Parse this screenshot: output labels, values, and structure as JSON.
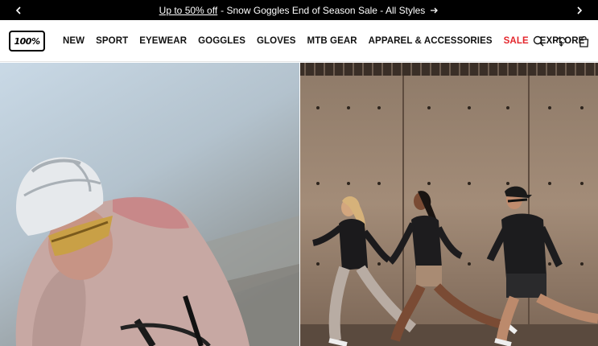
{
  "announcement": {
    "promo_link": "Up to 50% off",
    "message": " - Snow Goggles End of Season Sale - All Styles",
    "prev_icon": "chevron-left-icon",
    "next_icon": "chevron-right-icon"
  },
  "header": {
    "logo_text": "100%",
    "nav": [
      {
        "label": "NEW"
      },
      {
        "label": "SPORT"
      },
      {
        "label": "EYEWEAR"
      },
      {
        "label": "GOGGLES"
      },
      {
        "label": "GLOVES"
      },
      {
        "label": "MTB GEAR"
      },
      {
        "label": "APPAREL & ACCESSORIES"
      },
      {
        "label": "SALE"
      },
      {
        "label": "EXPLORE"
      }
    ],
    "icons": [
      "search-icon",
      "account-icon",
      "cart-icon"
    ],
    "sale_color": "#e4262c"
  },
  "hero": {
    "left_image": "cyclist-with-helmet-and-sunglasses",
    "right_image": "three-runners-in-front-of-concrete-wall"
  }
}
